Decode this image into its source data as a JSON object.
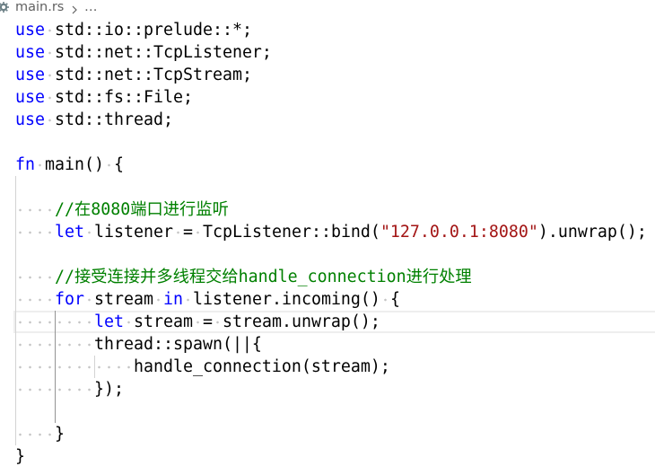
{
  "colors": {
    "keyword": "#0000ff",
    "string": "#a31515",
    "comment": "#008000",
    "text": "#000000",
    "breadcrumb_text": "#616161",
    "file_icon": "#6d8086",
    "whitespace_marker": "#c4c4c4",
    "indent_guide": "#d3d3d3",
    "indent_guide_active": "#939393",
    "current_line_border": "#eeeeee"
  },
  "breadcrumb": {
    "file_icon": "rust-file-icon",
    "file_name": "main.rs",
    "separator_icon": "chevron-right-icon",
    "symbol_path": "…"
  },
  "editor": {
    "lines": [
      [
        {
          "keyword": "use"
        },
        {
          "whitespace": " "
        },
        {
          "text": "std::io::prelude::*;"
        }
      ],
      [
        {
          "keyword": "use"
        },
        {
          "whitespace": " "
        },
        {
          "text": "std::net::TcpListener;"
        }
      ],
      [
        {
          "keyword": "use"
        },
        {
          "whitespace": " "
        },
        {
          "text": "std::net::TcpStream;"
        }
      ],
      [
        {
          "keyword": "use"
        },
        {
          "whitespace": " "
        },
        {
          "text": "std::fs::File;"
        }
      ],
      [
        {
          "keyword": "use"
        },
        {
          "whitespace": " "
        },
        {
          "text": "std::thread;"
        }
      ],
      [],
      [
        {
          "keyword": "fn"
        },
        {
          "whitespace": " "
        },
        {
          "text": "main()"
        },
        {
          "whitespace": " "
        },
        {
          "text": "{"
        }
      ],
      [],
      [
        {
          "whitespace": "    "
        },
        {
          "comment": "//在8080端口进行监听"
        }
      ],
      [
        {
          "whitespace": "    "
        },
        {
          "keyword": "let"
        },
        {
          "whitespace": " "
        },
        {
          "text": "listener"
        },
        {
          "whitespace": " "
        },
        {
          "text": "="
        },
        {
          "whitespace": " "
        },
        {
          "text": "TcpListener::bind("
        },
        {
          "string": "\"127.0.0.1:8080\""
        },
        {
          "text": ").unwrap();"
        }
      ],
      [],
      [
        {
          "whitespace": "    "
        },
        {
          "comment": "//接受连接并多线程交给handle_connection进行处理"
        }
      ],
      [
        {
          "whitespace": "    "
        },
        {
          "keyword": "for"
        },
        {
          "whitespace": " "
        },
        {
          "text": "stream"
        },
        {
          "whitespace": " "
        },
        {
          "keyword": "in"
        },
        {
          "whitespace": " "
        },
        {
          "text": "listener.incoming()"
        },
        {
          "whitespace": " "
        },
        {
          "text": "{"
        }
      ],
      [
        {
          "whitespace": "        "
        },
        {
          "keyword": "let"
        },
        {
          "whitespace": " "
        },
        {
          "text": "stream"
        },
        {
          "whitespace": " "
        },
        {
          "text": "="
        },
        {
          "whitespace": " "
        },
        {
          "text": "stream.unwrap();"
        }
      ],
      [
        {
          "whitespace": "        "
        },
        {
          "text": "thread::spawn(||{"
        }
      ],
      [
        {
          "whitespace": "            "
        },
        {
          "text": "handle_connection(stream);"
        }
      ],
      [
        {
          "whitespace": "        "
        },
        {
          "text": "});"
        }
      ],
      [],
      [
        {
          "whitespace": "    "
        },
        {
          "text": "}"
        }
      ],
      [
        {
          "text": "}"
        }
      ]
    ]
  }
}
